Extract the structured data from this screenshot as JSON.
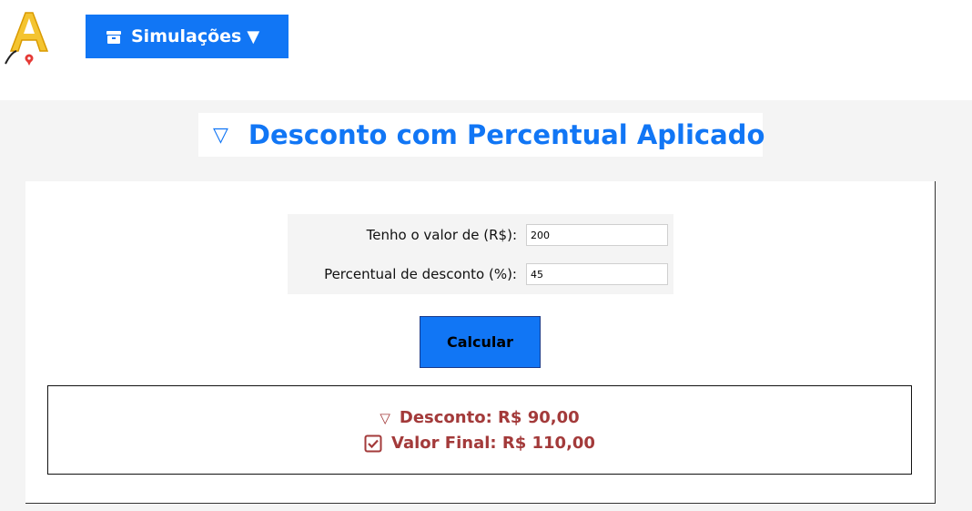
{
  "header": {
    "menu_label": "Simulações",
    "menu_caret": "▼",
    "menu_icon": "box-icon"
  },
  "page": {
    "title": "Desconto com Percentual Aplicado",
    "title_icon": "▽"
  },
  "form": {
    "value_label": "Tenho o valor de (R$):",
    "value": "200",
    "percent_label": "Percentual de desconto (%):",
    "percent": "45",
    "calculate_label": "Calcular"
  },
  "result": {
    "discount_icon": "▽",
    "discount_text": "Desconto: R$ 90,00",
    "final_text": "Valor Final: R$ 110,00"
  },
  "colors": {
    "accent": "#1176f5",
    "result_text": "#a33a3a",
    "logo_yellow": "#f4c430"
  }
}
